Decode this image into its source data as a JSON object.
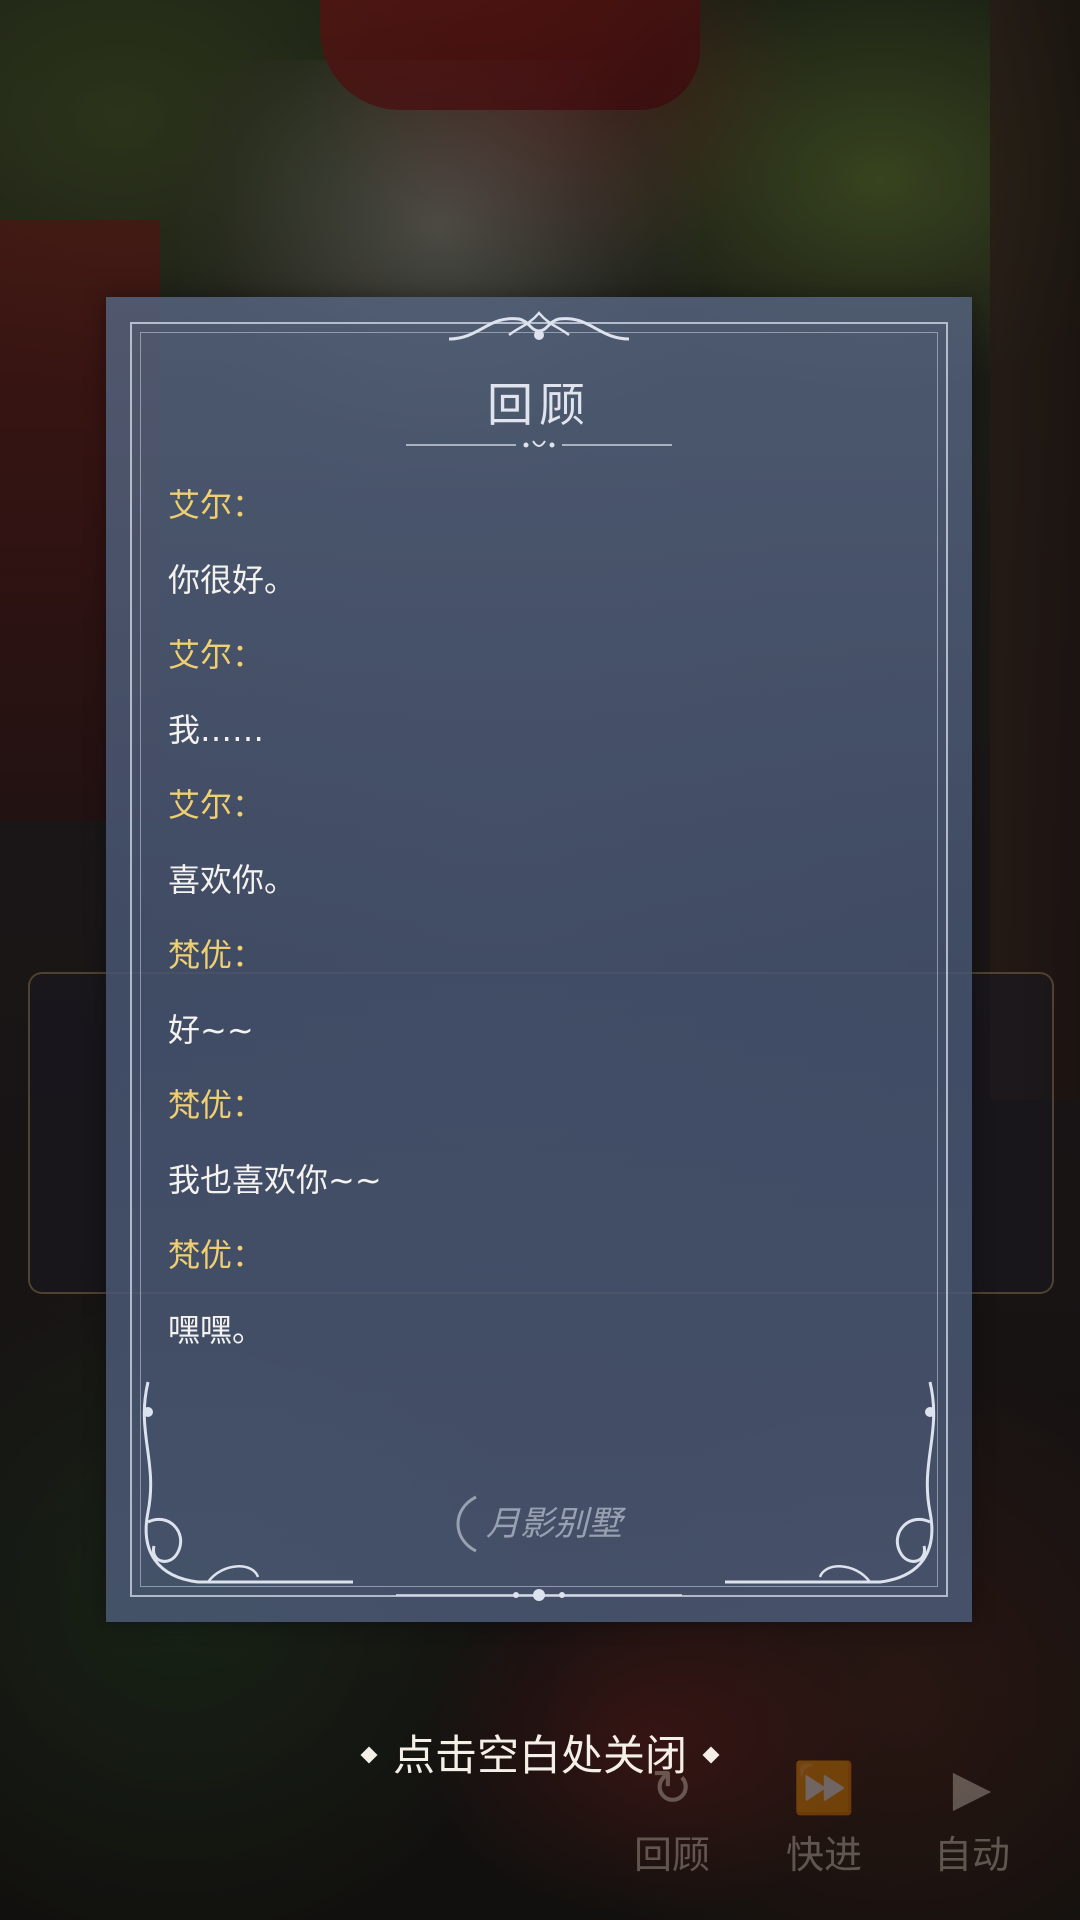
{
  "review": {
    "title": "回顾",
    "entries": [
      {
        "speaker": "艾尔：",
        "line": "你很好。"
      },
      {
        "speaker": "艾尔：",
        "line": "我……"
      },
      {
        "speaker": "艾尔：",
        "line": "喜欢你。"
      },
      {
        "speaker": "梵优：",
        "line": "好~~"
      },
      {
        "speaker": "梵优：",
        "line": "我也喜欢你~~"
      },
      {
        "speaker": "梵优：",
        "line": "嘿嘿。"
      }
    ],
    "watermark": "月影别墅"
  },
  "close_hint": "点击空白处关闭",
  "controls": {
    "review_label": "回顾",
    "fast_forward_label": "快进",
    "auto_label": "自动"
  },
  "colors": {
    "panel": "#54627c",
    "speaker_name": "#f0cf73",
    "dialogue_text": "#f4f2ee"
  }
}
